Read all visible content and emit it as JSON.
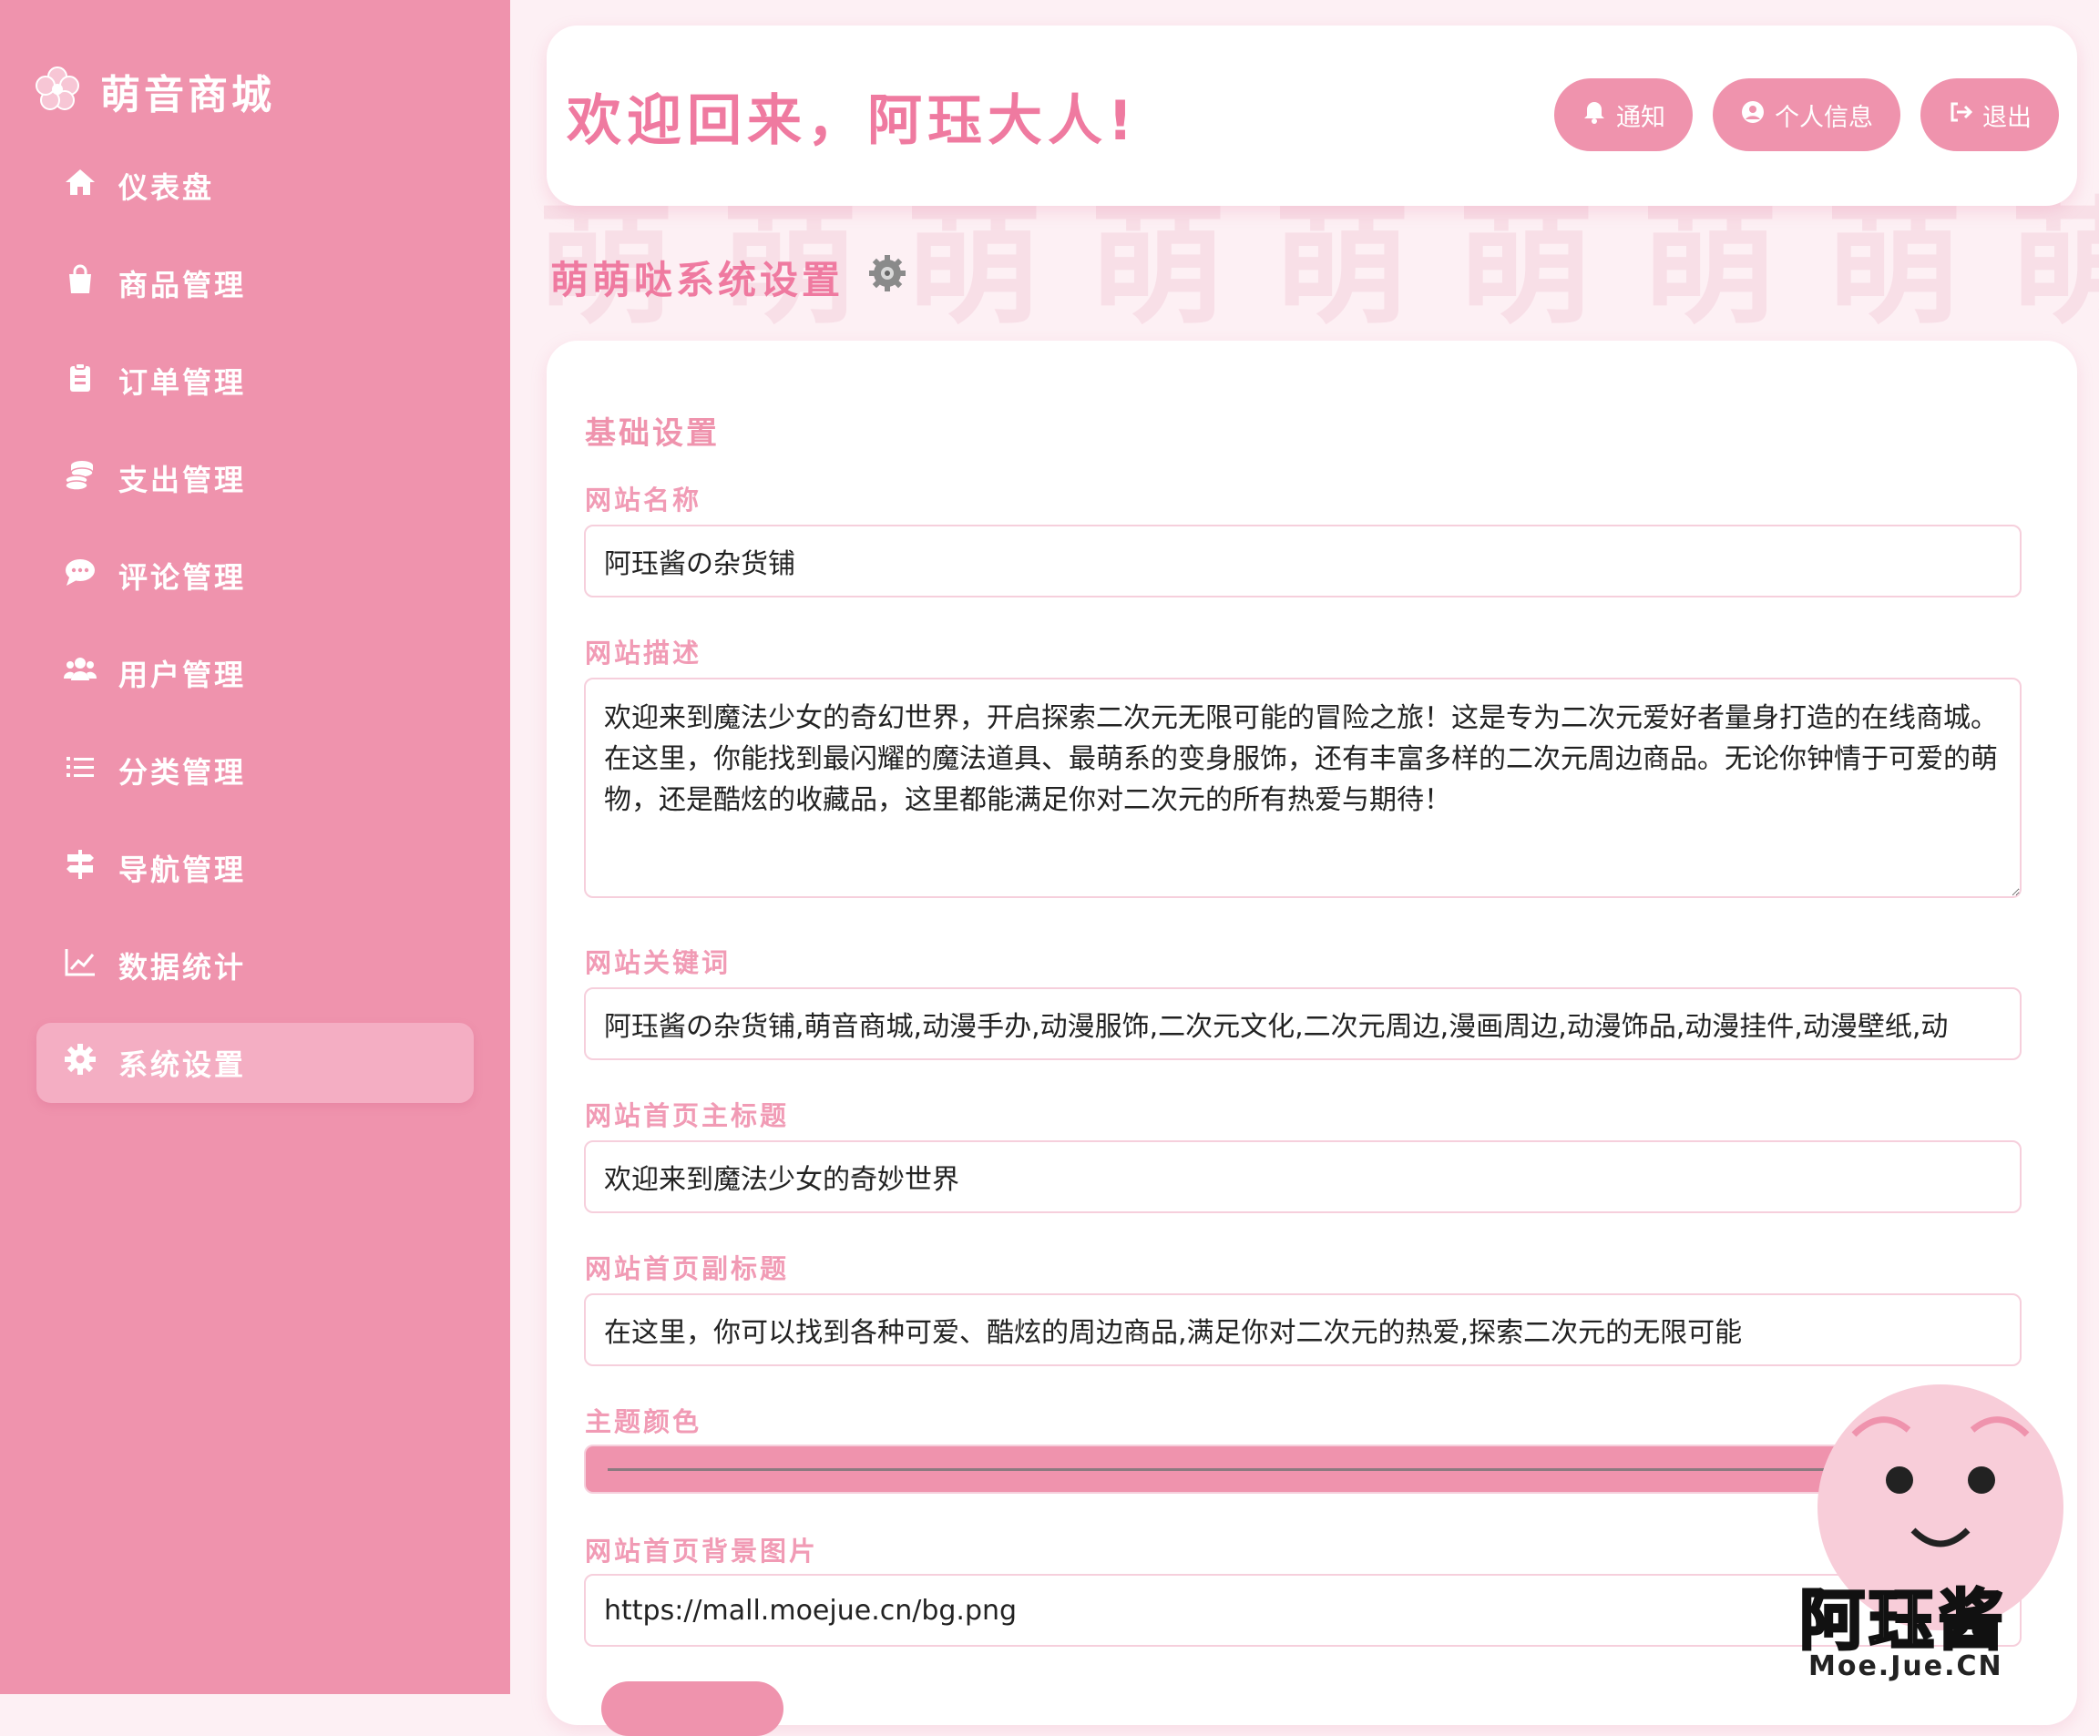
{
  "brand": {
    "name": "萌音商城",
    "icon": "sakura-flower-icon"
  },
  "sidebar": {
    "items": [
      {
        "label": "仪表盘",
        "icon": "home-icon"
      },
      {
        "label": "商品管理",
        "icon": "shopping-bag-icon"
      },
      {
        "label": "订单管理",
        "icon": "clipboard-icon"
      },
      {
        "label": "支出管理",
        "icon": "coins-icon"
      },
      {
        "label": "评论管理",
        "icon": "comment-icon"
      },
      {
        "label": "用户管理",
        "icon": "users-icon"
      },
      {
        "label": "分类管理",
        "icon": "list-icon"
      },
      {
        "label": "导航管理",
        "icon": "signpost-icon"
      },
      {
        "label": "数据统计",
        "icon": "chart-line-icon"
      },
      {
        "label": "系统设置",
        "icon": "gear-icon",
        "active": true
      }
    ]
  },
  "header": {
    "welcome": "欢迎回来，阿珏大人!",
    "buttons": {
      "notify": "通知",
      "profile": "个人信息",
      "logout": "退出"
    }
  },
  "page": {
    "title": "萌萌哒系统设置",
    "watermark": "萌萌萌萌萌萌萌萌萌萌萌"
  },
  "settings": {
    "group_title": "基础设置",
    "site_name": {
      "label": "网站名称",
      "value": "阿珏酱の杂货铺"
    },
    "site_description": {
      "label": "网站描述",
      "value": "欢迎来到魔法少女的奇幻世界，开启探索二次元无限可能的冒险之旅！这是专为二次元爱好者量身打造的在线商城。在这里，你能找到最闪耀的魔法道具、最萌系的变身服饰，还有丰富多样的二次元周边商品。无论你钟情于可爱的萌物，还是酷炫的收藏品，这里都能满足你对二次元的所有热爱与期待！"
    },
    "site_keywords": {
      "label": "网站关键词",
      "value": "阿珏酱の杂货铺,萌音商城,动漫手办,动漫服饰,二次元文化,二次元周边,漫画周边,动漫饰品,动漫挂件,动漫壁纸,动"
    },
    "home_title": {
      "label": "网站首页主标题",
      "value": "欢迎来到魔法少女的奇妙世界"
    },
    "home_subtitle": {
      "label": "网站首页副标题",
      "value": "在这里，你可以找到各种可爱、酷炫的周边商品,满足你对二次元的热爱,探索二次元的无限可能"
    },
    "theme_color": {
      "label": "主题颜色",
      "value": "#ef93ad"
    },
    "home_bg": {
      "label": "网站首页背景图片",
      "value": "https://mall.moejue.cn/bg.png"
    }
  },
  "watermark_logo": {
    "title": "阿珏酱",
    "subtitle": "Moe.Jue.CN"
  }
}
